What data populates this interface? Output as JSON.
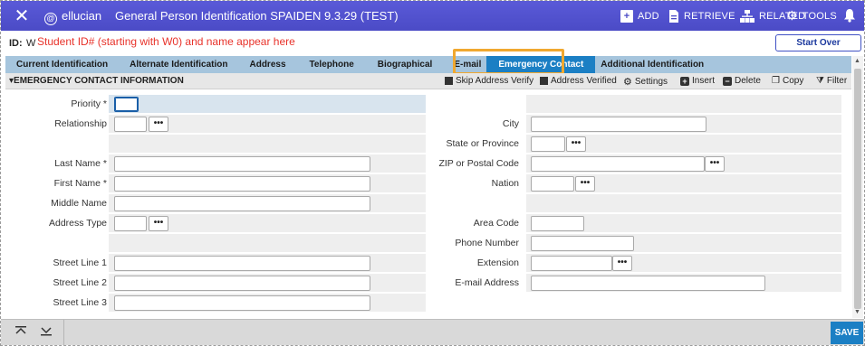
{
  "topbar": {
    "brand": "ellucian",
    "title": "General Person Identification SPAIDEN 9.3.29 (TEST)",
    "add_label": "ADD",
    "retrieve_label": "RETRIEVE",
    "related_label": "RELATED",
    "tools_label": "TOOLS",
    "accent": "#4b4bc6"
  },
  "idrow": {
    "id_label": "ID:",
    "id_value_fragment": "W",
    "annotation": "Student ID# (starting with W0) and name appear here",
    "start_over": "Start Over"
  },
  "tabs": [
    {
      "label": "Current Identification"
    },
    {
      "label": "Alternate Identification"
    },
    {
      "label": "Address"
    },
    {
      "label": "Telephone"
    },
    {
      "label": "Biographical"
    },
    {
      "label": "E-mail"
    },
    {
      "label": "Emergency Contact",
      "active": true
    },
    {
      "label": "Additional Identification"
    }
  ],
  "section": {
    "title": "EMERGENCY CONTACT INFORMATION",
    "skip_address_verify": "Skip Address Verify",
    "address_verified": "Address Verified",
    "settings": "Settings",
    "insert": "Insert",
    "delete": "Delete",
    "copy": "Copy",
    "filter": "Filter"
  },
  "form_left": {
    "priority": "Priority *",
    "relationship": "Relationship",
    "last_name": "Last Name *",
    "first_name": "First Name *",
    "middle_name": "Middle Name",
    "address_type": "Address Type",
    "street1": "Street Line 1",
    "street2": "Street Line 2",
    "street3": "Street Line 3"
  },
  "form_right": {
    "city": "City",
    "state": "State or Province",
    "zip": "ZIP or Postal Code",
    "nation": "Nation",
    "area_code": "Area Code",
    "phone": "Phone Number",
    "extension": "Extension",
    "email": "E-mail Address"
  },
  "bottombar": {
    "save": "SAVE"
  }
}
